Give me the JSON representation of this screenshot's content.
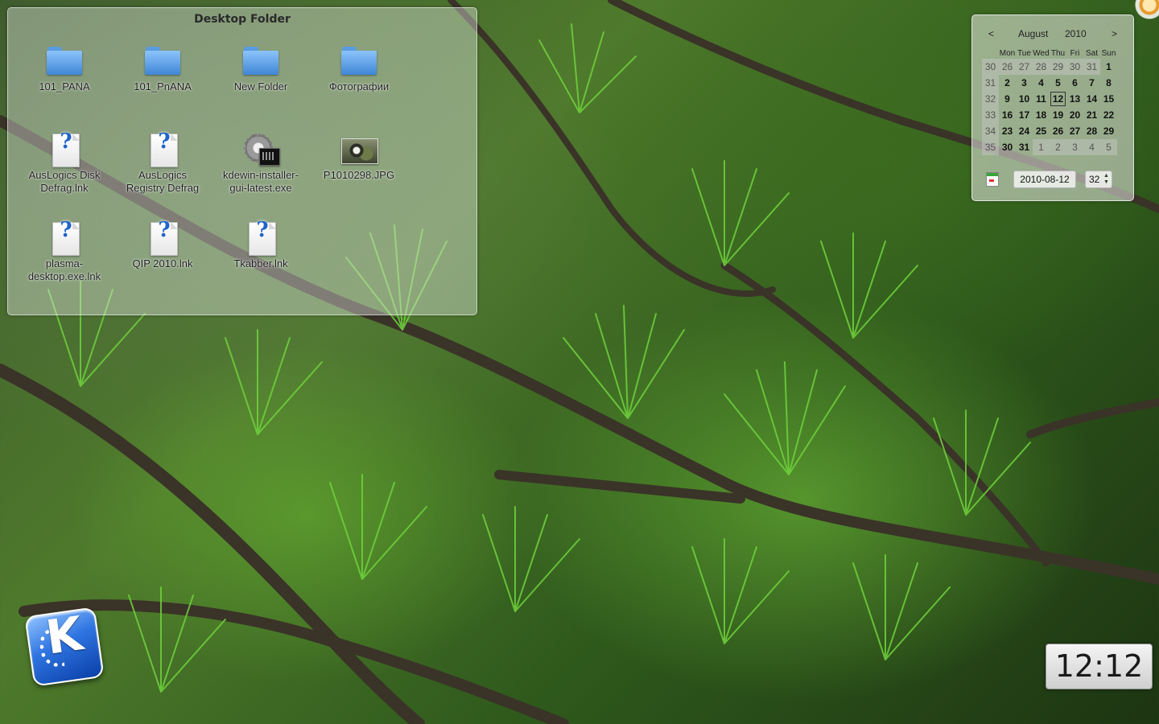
{
  "folderview": {
    "title": "Desktop Folder",
    "items": [
      {
        "label_lines": [
          "101_PANA",
          ""
        ],
        "icon": "folder-icon"
      },
      {
        "label_lines": [
          "101_PnANA",
          ""
        ],
        "icon": "folder-icon"
      },
      {
        "label_lines": [
          "New Folder",
          ""
        ],
        "icon": "folder-icon"
      },
      {
        "label_lines": [
          "Фотографии",
          ""
        ],
        "icon": "folder-icon"
      },
      {
        "label_lines": [
          "AusLogics Disk",
          "Defrag.lnk"
        ],
        "icon": "unknown-file-icon"
      },
      {
        "label_lines": [
          "AusLogics",
          "Registry Defrag"
        ],
        "icon": "unknown-file-icon"
      },
      {
        "label_lines": [
          "kdewin-installer-",
          "gui-latest.exe"
        ],
        "icon": "executable-icon"
      },
      {
        "label_lines": [
          "P1010298.JPG",
          ""
        ],
        "icon": "image-file-icon"
      },
      {
        "label_lines": [
          "plasma-",
          "desktop.exe.lnk"
        ],
        "icon": "unknown-file-icon"
      },
      {
        "label_lines": [
          "QIP 2010.lnk",
          ""
        ],
        "icon": "unknown-file-icon"
      },
      {
        "label_lines": [
          "Tkabber.lnk",
          ""
        ],
        "icon": "unknown-file-icon"
      }
    ]
  },
  "calendar": {
    "prev": "<",
    "next": ">",
    "month": "August",
    "year": "2010",
    "weekday_headers": [
      "Mon",
      "Tue",
      "Wed",
      "Thu",
      "Fri",
      "Sat",
      "Sun"
    ],
    "weeks": [
      {
        "week": "30",
        "days": [
          "26",
          "27",
          "28",
          "29",
          "30",
          "31",
          "1"
        ]
      },
      {
        "week": "31",
        "days": [
          "2",
          "3",
          "4",
          "5",
          "6",
          "7",
          "8"
        ]
      },
      {
        "week": "32",
        "days": [
          "9",
          "10",
          "11",
          "12",
          "13",
          "14",
          "15"
        ]
      },
      {
        "week": "33",
        "days": [
          "16",
          "17",
          "18",
          "19",
          "20",
          "21",
          "22"
        ]
      },
      {
        "week": "34",
        "days": [
          "23",
          "24",
          "25",
          "26",
          "27",
          "28",
          "29"
        ]
      },
      {
        "week": "35",
        "days": [
          "30",
          "31",
          "1",
          "2",
          "3",
          "4",
          "5"
        ]
      }
    ],
    "selected_day": "12",
    "date_value": "2010-08-12",
    "week_value": "32",
    "icon": "calendar-icon"
  },
  "clock": {
    "time": "12:12"
  },
  "launcher": {
    "icon": "kde-logo-icon",
    "letter": "K"
  },
  "cashew": {
    "icon": "plasma-cashew-icon"
  }
}
